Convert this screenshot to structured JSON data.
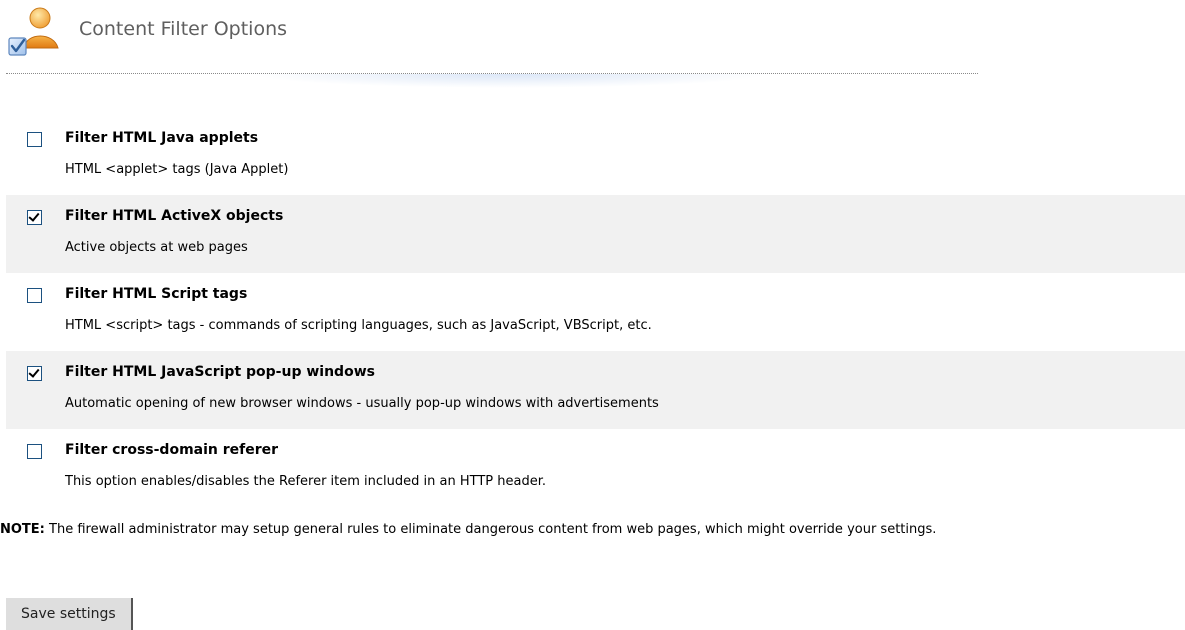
{
  "header": {
    "title": "Content Filter Options",
    "icon": "user-settings-icon"
  },
  "options": [
    {
      "title": "Filter HTML Java applets",
      "description": "HTML <applet> tags (Java Applet)",
      "checked": false
    },
    {
      "title": "Filter HTML ActiveX objects",
      "description": "Active objects at web pages",
      "checked": true
    },
    {
      "title": "Filter HTML Script tags",
      "description": "HTML <script> tags - commands of scripting languages, such as JavaScript, VBScript, etc.",
      "checked": false
    },
    {
      "title": "Filter HTML JavaScript pop-up windows",
      "description": "Automatic opening of new browser windows - usually pop-up windows with advertisements",
      "checked": true
    },
    {
      "title": "Filter cross-domain referer",
      "description": "This option enables/disables the Referer item included in an HTTP header.",
      "checked": false
    }
  ],
  "note": {
    "label": "NOTE:",
    "text": " The firewall administrator may setup general rules to eliminate dangerous content from web pages, which might override your settings."
  },
  "actions": {
    "save_label": "Save settings"
  },
  "colors": {
    "shaded_row": "#f1f1f1",
    "checkbox_border": "#1c5180",
    "title_gray": "#5f5f5f"
  }
}
